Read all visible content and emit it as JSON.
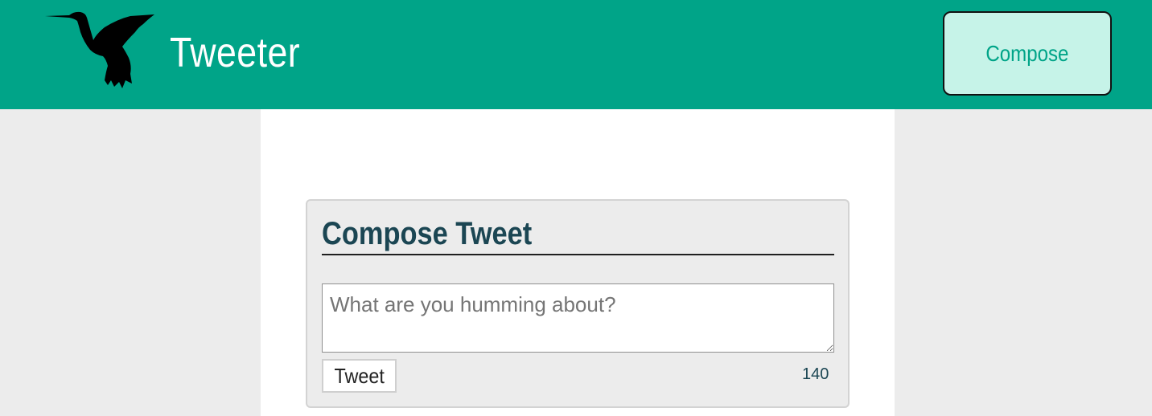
{
  "header": {
    "brand": "Tweeter",
    "compose_label": "Compose",
    "logo_icon": "hummingbird-icon",
    "background_color": "#00a488"
  },
  "new_tweet": {
    "title": "Compose Tweet",
    "placeholder": "What are you humming about?",
    "value": "",
    "submit_label": "Tweet",
    "char_counter": "140"
  }
}
